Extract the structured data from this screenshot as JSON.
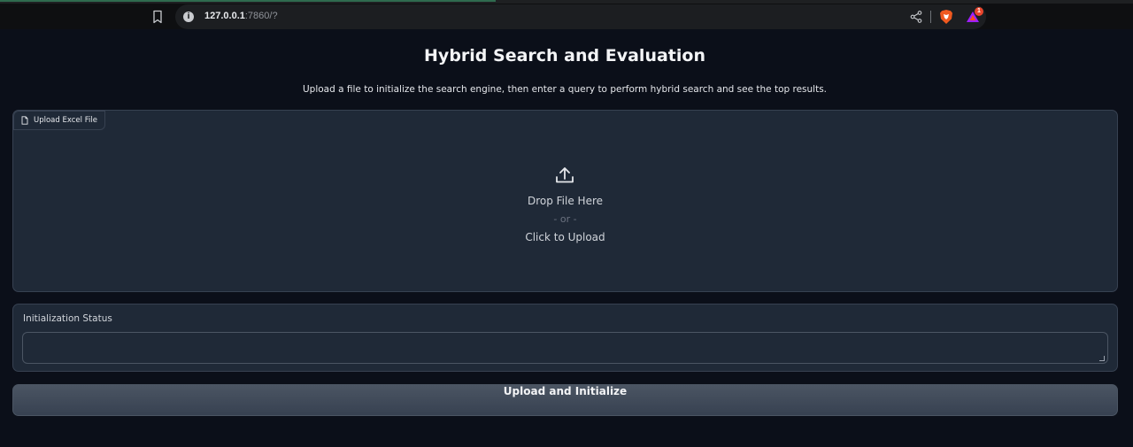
{
  "browser": {
    "url_host": "127.0.0.1",
    "url_rest": ":7860/?",
    "notification_count": "1",
    "icons": [
      "bookmark-icon",
      "site-info-icon",
      "share-icon",
      "brave-shields-icon",
      "brave-rewards-icon"
    ]
  },
  "app": {
    "title": "Hybrid Search and Evaluation",
    "description": "Upload a file to initialize the search engine, then enter a query to perform hybrid search and see the top results."
  },
  "upload": {
    "label": "Upload Excel File",
    "drop_text": "Drop File Here",
    "or_text": "- or -",
    "click_text": "Click to Upload",
    "icons": [
      "file-icon",
      "upload-icon"
    ]
  },
  "status": {
    "label": "Initialization Status",
    "value": ""
  },
  "button": {
    "label": "Upload and Initialize"
  },
  "colors": {
    "background": "#0b0f19",
    "panel": "#1f2937",
    "border": "#374151",
    "button_top": "#4b5563",
    "button_bottom": "#374151"
  }
}
